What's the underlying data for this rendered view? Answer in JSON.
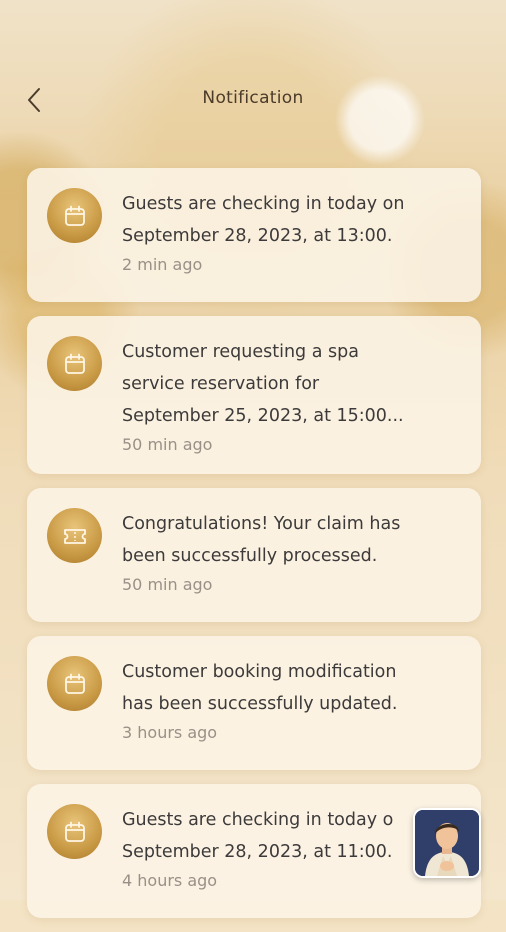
{
  "header": {
    "title": "Notification"
  },
  "notifications": [
    {
      "icon": "calendar-icon",
      "text": "Guests are checking in today on\nSeptember 28, 2023, at 13:00.",
      "time": "2 min ago"
    },
    {
      "icon": "calendar-icon",
      "text": "Customer requesting a spa\nservice reservation for\nSeptember 25, 2023, at 15:00...",
      "time": "50 min ago"
    },
    {
      "icon": "ticket-icon",
      "text": "Congratulations! Your claim has\nbeen successfully processed.",
      "time": "50 min ago"
    },
    {
      "icon": "calendar-icon",
      "text": "Customer booking modification\nhas been successfully updated.",
      "time": "3 hours ago"
    },
    {
      "icon": "calendar-icon",
      "text": "Guests are checking in today o\nSeptember 28, 2023, at 11:00.",
      "time": "4 hours ago"
    }
  ],
  "colors": {
    "accent_gold": "#c99a45",
    "card_background": "#fcf4e6",
    "text_primary": "#3c3a3a",
    "text_secondary": "#9a9087"
  }
}
